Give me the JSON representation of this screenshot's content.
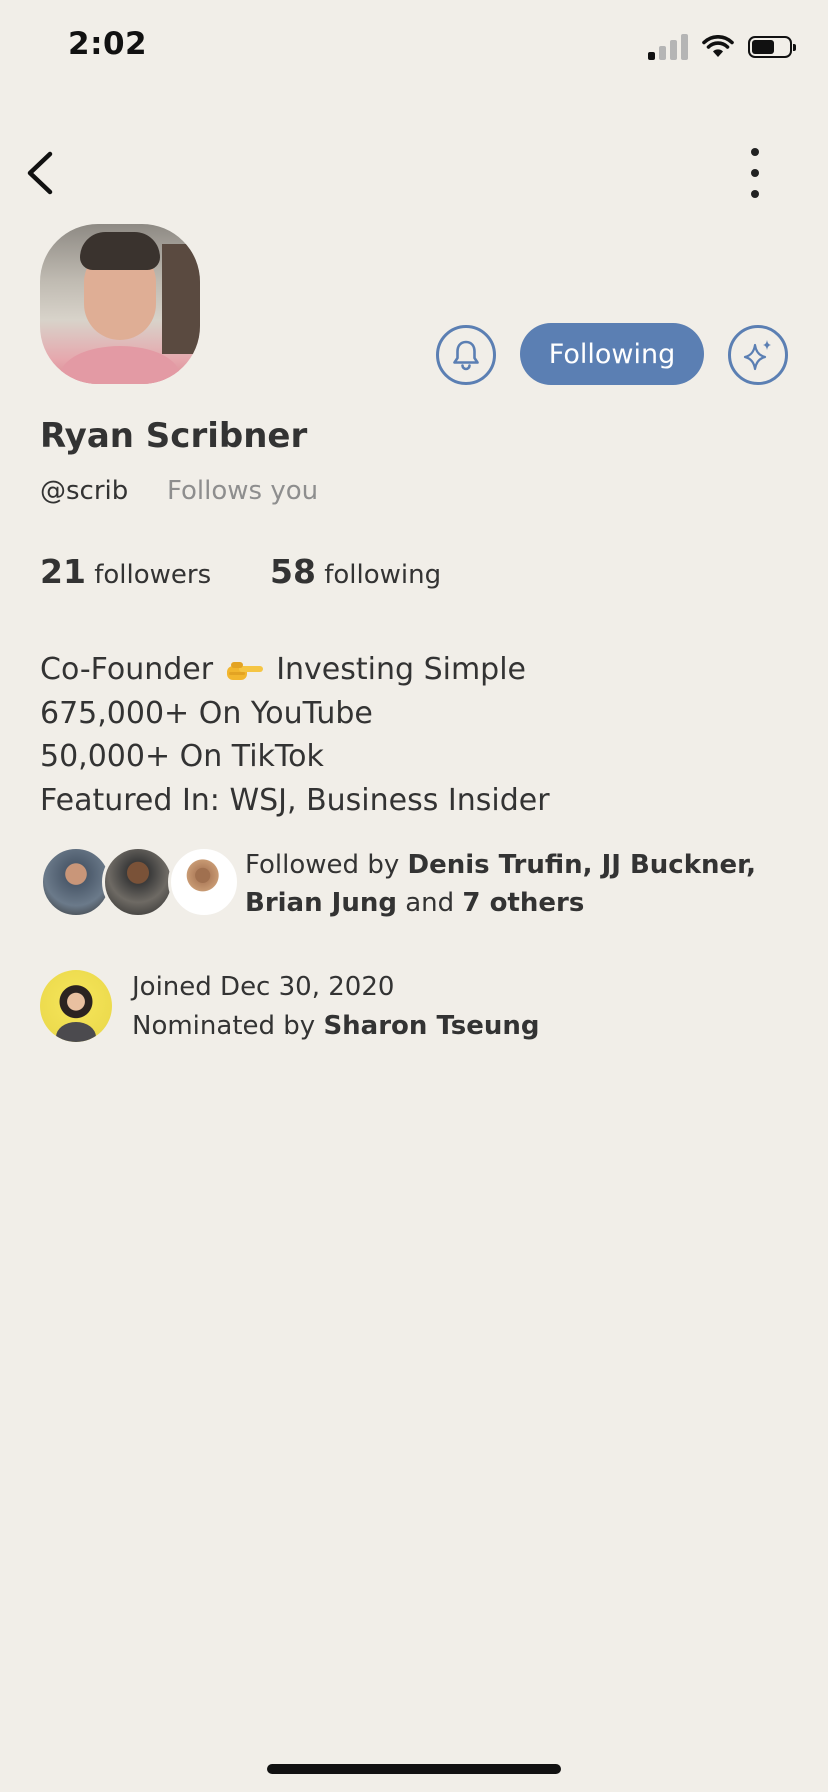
{
  "status_bar": {
    "time": "2:02"
  },
  "profile": {
    "name": "Ryan Scribner",
    "handle": "@scrib",
    "follows_you": "Follows you",
    "following_button": "Following",
    "followers_count": "21",
    "followers_label": "followers",
    "following_count": "58",
    "following_label": "following"
  },
  "bio": {
    "line1_before": "Co-Founder",
    "line1_emoji": "pointing-right-hand-emoji",
    "line1_after": "Investing Simple",
    "line2": "675,000+ On YouTube",
    "line3": "50,000+ On TikTok",
    "line4": "Featured In: WSJ, Business Insider"
  },
  "followed_by": {
    "prefix": "Followed by",
    "names": "Denis Trufin, JJ Buckner,",
    "names2": "Brian Jung",
    "and": "and",
    "others": "7 others"
  },
  "joined": {
    "date_line": "Joined Dec 30, 2020",
    "nominated_prefix": "Nominated by",
    "nominated_by": "Sharon Tseung"
  },
  "icons": {
    "back": "chevron-left-icon",
    "more": "more-vertical-icon",
    "bell": "bell-icon",
    "sparkle": "sparkle-icon"
  },
  "colors": {
    "background": "#f1eee8",
    "accent": "#5b7fb3"
  }
}
